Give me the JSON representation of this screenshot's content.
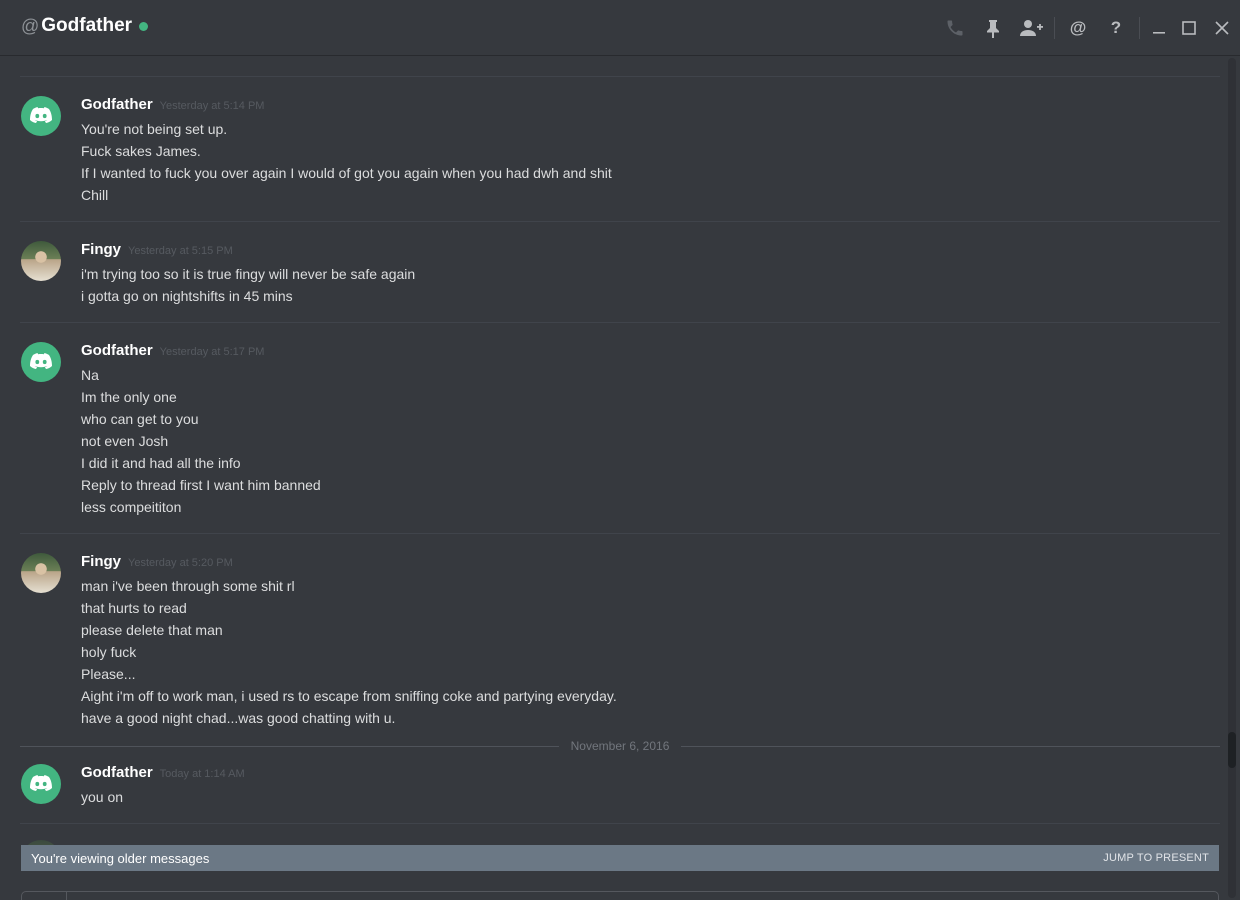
{
  "header": {
    "at_symbol": "@",
    "dm_name": "Godfather",
    "status_color": "#43b581",
    "icons": [
      "phone-icon",
      "pin-icon",
      "add-user-icon",
      "mention-icon",
      "help-icon",
      "minimize-icon",
      "maximize-icon",
      "close-icon"
    ],
    "mention_glyph": "@",
    "help_glyph": "?"
  },
  "messages": [
    {
      "username": "Godfather",
      "timestamp": "Yesterday at 5:14 PM",
      "avatar": "discord-logo-avatar",
      "lines": [
        "You're not being set up.",
        "Fuck sakes James.",
        "If I wanted to fuck you over again I would of got you again when you had dwh and shit",
        "Chill"
      ]
    },
    {
      "username": "Fingy",
      "timestamp": "Yesterday at 5:15 PM",
      "avatar": "photo-avatar",
      "lines": [
        "i'm trying too so it is true fingy will never be safe again",
        "i gotta go on nightshifts in 45 mins"
      ]
    },
    {
      "username": "Godfather",
      "timestamp": "Yesterday at 5:17 PM",
      "avatar": "discord-logo-avatar",
      "lines": [
        "Na",
        "Im the only one",
        "who can get to you",
        "not even Josh",
        "I did it and had all the info",
        "Reply to thread first I want him banned",
        "less compeititon"
      ]
    },
    {
      "username": "Fingy",
      "timestamp": "Yesterday at 5:20 PM",
      "avatar": "photo-avatar",
      "lines": [
        "man i've been through some shit rl",
        "that hurts to read",
        "please delete that man",
        "holy fuck",
        "Please...",
        "Aight i'm off to work man, i used rs to escape from sniffing coke and partying everyday.",
        "have a good night chad...was good chatting with u."
      ]
    },
    {
      "username": "Godfather",
      "timestamp": "Today at 1:14 AM",
      "avatar": "discord-logo-avatar",
      "lines": [
        "you on"
      ]
    }
  ],
  "date_separator": "November 6, 2016",
  "older_messages_bar": {
    "text": "You're viewing older messages",
    "jump_label": "JUMP TO PRESENT"
  }
}
